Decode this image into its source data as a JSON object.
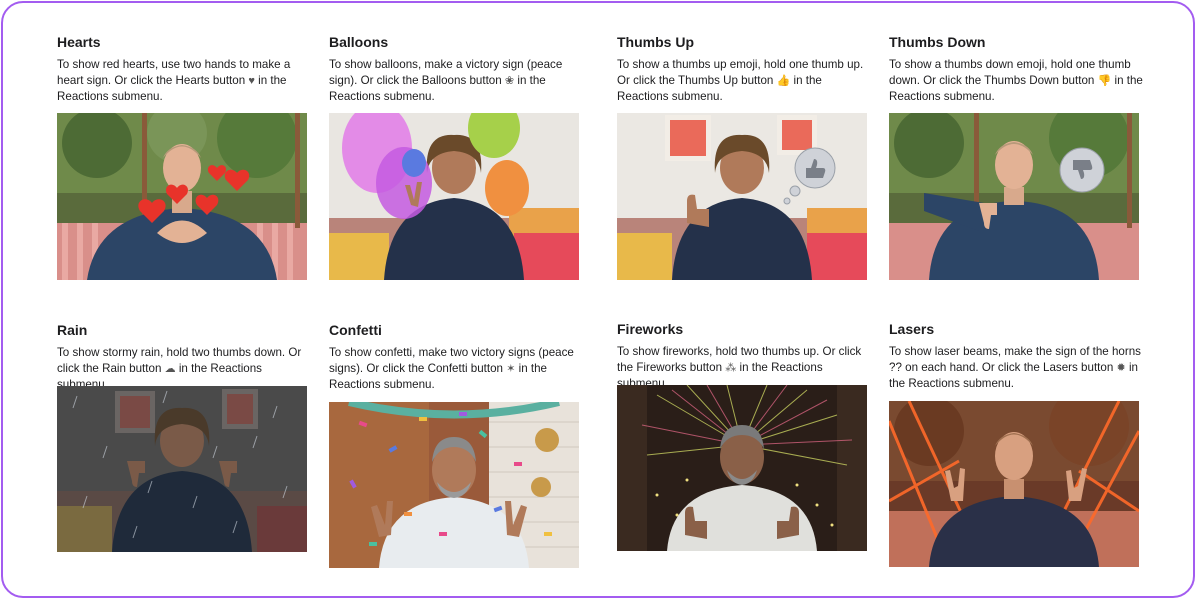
{
  "cards": [
    {
      "title": "Hearts",
      "desc_pre": "To show red hearts, use two hands to make a heart sign. Or click the Hearts button ",
      "icon": "heart-icon",
      "glyph": "♥",
      "desc_post": " in the Reactions submenu."
    },
    {
      "title": "Balloons",
      "desc_pre": "To show balloons, make a victory sign (peace sign). Or click the Balloons button ",
      "icon": "balloon-icon",
      "glyph": "❀",
      "desc_post": " in the Reactions submenu."
    },
    {
      "title": "Thumbs Up",
      "desc_pre": "To show a thumbs up emoji, hold one thumb up. Or click the Thumbs Up button ",
      "icon": "thumbs-up-icon",
      "glyph": "👍",
      "desc_post": " in the Reactions submenu."
    },
    {
      "title": "Thumbs Down",
      "desc_pre": "To show a thumbs down emoji, hold one thumb down. Or click the Thumbs Down button ",
      "icon": "thumbs-down-icon",
      "glyph": "👎",
      "desc_post": " in the Reactions submenu."
    },
    {
      "title": "Rain",
      "desc_pre": "To show stormy rain, hold two thumbs down. Or click the Rain button ",
      "icon": "rain-cloud-icon",
      "glyph": "☁",
      "desc_post": " in the Reactions submenu."
    },
    {
      "title": "Confetti",
      "desc_pre": "To show confetti, make two victory signs (peace signs). Or click the Confetti button ",
      "icon": "party-popper-icon",
      "glyph": "✶",
      "desc_post": " in the Reactions submenu."
    },
    {
      "title": "Fireworks",
      "desc_pre": "To show fireworks, hold two thumbs up. Or click the Fireworks button ",
      "icon": "fireworks-icon",
      "glyph": "⁂",
      "desc_post": " in the Reactions submenu."
    },
    {
      "title": "Lasers",
      "desc_pre": "To show laser beams, make the sign of the horns ?? on each hand. Or click the Lasers button ",
      "icon": "lasers-icon",
      "glyph": "✹",
      "desc_post": " in the Reactions submenu."
    }
  ],
  "colors": {
    "border": "#a35cf0",
    "heart": "#e8332a",
    "shirt": "#1f3550",
    "laser": "#ff6a2a"
  }
}
